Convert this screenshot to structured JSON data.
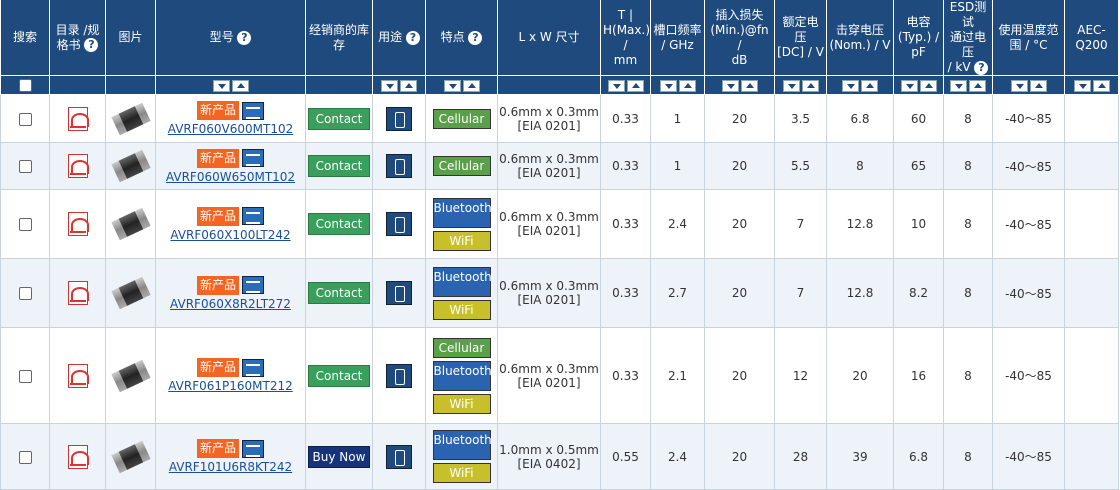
{
  "headers": {
    "search": "搜索",
    "catalog_a": "目录 /",
    "catalog_b": "规",
    "catalog_c": "格书",
    "image": "图片",
    "model": "型号",
    "stock_a": "经销商的库",
    "stock_b": "存",
    "usage": "用途",
    "features": "特点",
    "size": "L x W 尺寸",
    "thickness_a": "T |",
    "thickness_b": "H(Max.) /",
    "thickness_c": "mm",
    "freq_a": "槽口频率",
    "freq_b": "/ GHz",
    "loss_a": "插入损失",
    "loss_b": "(Min.)@fn /",
    "loss_c": "dB",
    "rated_a": "额定电压",
    "rated_b": "[DC] / V",
    "break_a": "击穿电压",
    "break_b": "(Nom.) / V",
    "cap_a": "电容",
    "cap_b": "(Typ.) /",
    "cap_c": "pF",
    "esd_a": "ESD测试",
    "esd_b": "通过电压",
    "esd_c": "/ kV",
    "temp_a": "使用温度范",
    "temp_b": "围 / °C",
    "aec_a": "AEC-",
    "aec_b": "Q200",
    "help": "?"
  },
  "new_label": "新产品",
  "rows": [
    {
      "model": "AVRF060V600MT102",
      "stock": "Contact",
      "stock_type": "contact",
      "features": [
        "Cellular"
      ],
      "size_a": "0.6mm x 0.3mm",
      "size_b": "[EIA 0201]",
      "t": "0.33",
      "freq": "1",
      "loss": "20",
      "rated": "3.5",
      "breakdown": "6.8",
      "cap": "60",
      "esd": "8",
      "temp": "-40～85",
      "aec": ""
    },
    {
      "model": "AVRF060W650MT102",
      "stock": "Contact",
      "stock_type": "contact",
      "features": [
        "Cellular"
      ],
      "size_a": "0.6mm x 0.3mm",
      "size_b": "[EIA 0201]",
      "t": "0.33",
      "freq": "1",
      "loss": "20",
      "rated": "5.5",
      "breakdown": "8",
      "cap": "65",
      "esd": "8",
      "temp": "-40～85",
      "aec": ""
    },
    {
      "model": "AVRF060X100LT242",
      "stock": "Contact",
      "stock_type": "contact",
      "features": [
        "Bluetooth",
        "WiFi"
      ],
      "size_a": "0.6mm x 0.3mm",
      "size_b": "[EIA 0201]",
      "t": "0.33",
      "freq": "2.4",
      "loss": "20",
      "rated": "7",
      "breakdown": "12.8",
      "cap": "10",
      "esd": "8",
      "temp": "-40～85",
      "aec": ""
    },
    {
      "model": "AVRF060X8R2LT272",
      "stock": "Contact",
      "stock_type": "contact",
      "features": [
        "Bluetooth",
        "WiFi"
      ],
      "size_a": "0.6mm x 0.3mm",
      "size_b": "[EIA 0201]",
      "t": "0.33",
      "freq": "2.7",
      "loss": "20",
      "rated": "7",
      "breakdown": "12.8",
      "cap": "8.2",
      "esd": "8",
      "temp": "-40～85",
      "aec": ""
    },
    {
      "model": "AVRF061P160MT212",
      "stock": "Contact",
      "stock_type": "contact",
      "features": [
        "Cellular",
        "Bluetooth",
        "WiFi"
      ],
      "size_a": "0.6mm x 0.3mm",
      "size_b": "[EIA 0201]",
      "t": "0.33",
      "freq": "2.1",
      "loss": "20",
      "rated": "12",
      "breakdown": "20",
      "cap": "16",
      "esd": "8",
      "temp": "-40～85",
      "aec": ""
    },
    {
      "model": "AVRF101U6R8KT242",
      "stock": "Buy Now",
      "stock_type": "buy",
      "features": [
        "Bluetooth",
        "WiFi"
      ],
      "size_a": "1.0mm x 0.5mm",
      "size_b": "[EIA 0402]",
      "t": "0.55",
      "freq": "2.4",
      "loss": "20",
      "rated": "28",
      "breakdown": "39",
      "cap": "6.8",
      "esd": "8",
      "temp": "-40～85",
      "aec": ""
    }
  ]
}
